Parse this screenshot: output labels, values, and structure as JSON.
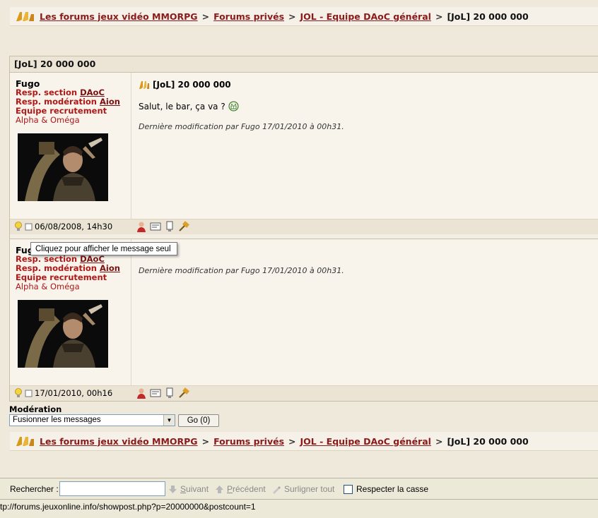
{
  "breadcrumb": {
    "items": [
      {
        "label": "Les forums jeux vidéo MMORPG"
      },
      {
        "label": "Forums privés"
      },
      {
        "label": "JOL - Equipe DAoC général"
      }
    ],
    "separator": ">",
    "current": "[JoL] 20 000 000"
  },
  "thread": {
    "title": "[JoL] 20 000 000"
  },
  "posts": [
    {
      "author": "Fugo",
      "role1_prefix": "Resp. section",
      "role1_link": "DAoC",
      "role2_prefix": "Resp. modération",
      "role2_link": "Aion",
      "role3": "Equipe recrutement",
      "guild": "Alpha & Oméga",
      "title": "[JoL] 20 000 000",
      "text": "Salut, le bar, ça va ?",
      "edit_note": "Dernière modification par Fugo 17/01/2010 à 00h31.",
      "date": "06/08/2008, 14h30"
    },
    {
      "author": "Fugo",
      "role1_prefix": "Resp. section",
      "role1_link": "DAoC",
      "role2_prefix": "Resp. modération",
      "role2_link": "Aion",
      "role3": "Equipe recrutement",
      "guild": "Alpha & Oméga",
      "edit_note": "Dernière modification par Fugo 17/01/2010 à 00h31.",
      "date": "17/01/2010, 00h16"
    }
  ],
  "tooltip": "Cliquez pour afficher le message seul",
  "moderation": {
    "label": "Modération",
    "selected": "Fusionner les messages",
    "go_label": "Go (0)"
  },
  "findbar": {
    "label": "Rechercher :",
    "input_value": "",
    "next": "Suivant",
    "next_key": "S",
    "previous": "Précédent",
    "previous_key": "P",
    "highlight": "Surligner tout",
    "highlight_key": "u",
    "match_case": "Respecter la casse",
    "match_case_key": "R"
  },
  "status": {
    "url": "tp://forums.jeuxonline.info/showpost.php?p=20000000&postcount=1"
  },
  "colors": {
    "link": "#8b1a1a",
    "role": "#b01818",
    "background": "#efe9dc"
  }
}
